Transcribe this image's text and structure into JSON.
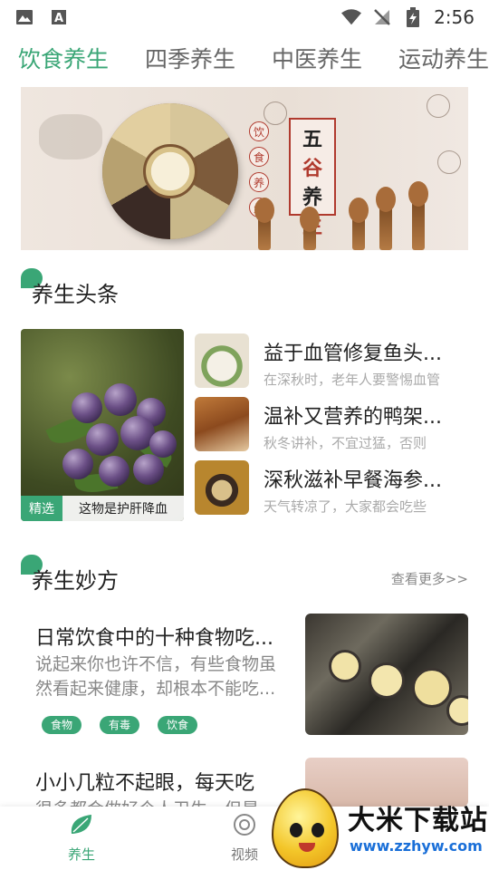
{
  "status_bar": {
    "time": "2:56",
    "left_icons": [
      "image-icon",
      "text-a-icon"
    ],
    "right_icons": [
      "wifi-icon",
      "no-signal-icon",
      "battery-charging-icon"
    ]
  },
  "tabs": [
    {
      "label": "饮食养生",
      "active": true
    },
    {
      "label": "四季养生",
      "active": false
    },
    {
      "label": "中医养生",
      "active": false
    },
    {
      "label": "运动养生",
      "active": false
    }
  ],
  "banner": {
    "badge_chars": [
      "饮",
      "食",
      "养",
      "生"
    ],
    "seal_chars": [
      "五",
      "谷",
      "养",
      "生"
    ]
  },
  "headlines": {
    "title": "养生头条",
    "featured": {
      "tag": "精选",
      "caption": "这物是护肝降血"
    },
    "items": [
      {
        "title": "益于血管修复鱼头...",
        "desc": "在深秋时，老年人要警惕血管"
      },
      {
        "title": "温补又营养的鸭架...",
        "desc": "秋冬讲补，不宜过猛，否则"
      },
      {
        "title": "深秋滋补早餐海参...",
        "desc": "天气转凉了，大家都会吃些"
      }
    ]
  },
  "recipes": {
    "title": "养生妙方",
    "more": "查看更多>>",
    "items": [
      {
        "title": "日常饮食中的十种食物吃...",
        "desc": "说起来你也许不信，有些食物虽然看起来健康，却根本不能吃...",
        "tags": [
          "食物",
          "有毒",
          "饮食"
        ]
      },
      {
        "title": "小小几粒不起眼，每天吃",
        "desc": "很多都会做好个人卫生，但是",
        "tags": []
      }
    ]
  },
  "bottom_nav": [
    {
      "label": "养生",
      "icon": "leaf-icon",
      "active": true
    },
    {
      "label": "视频",
      "icon": "video-icon",
      "active": false
    }
  ],
  "watermark": {
    "name": "大米下载站",
    "url": "www.zzhyw.com"
  },
  "colors": {
    "accent": "#3aa676"
  }
}
